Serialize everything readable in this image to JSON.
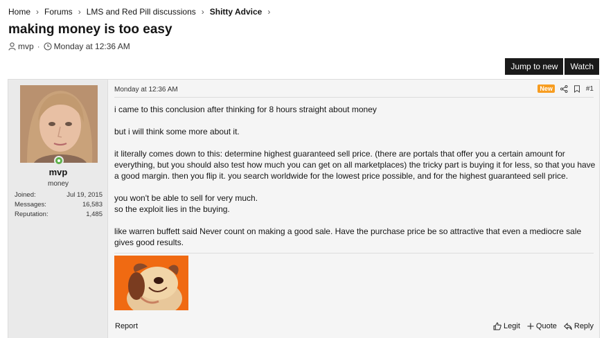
{
  "breadcrumb": {
    "items": [
      "Home",
      "Forums",
      "LMS and Red Pill discussions",
      "Shitty Advice"
    ]
  },
  "thread": {
    "title": "making money is too easy",
    "author": "mvp",
    "date": "Monday at 12:36 AM"
  },
  "buttons": {
    "jump_to_new": "Jump to new",
    "watch": "Watch"
  },
  "user": {
    "name": "mvp",
    "title": "money",
    "online": true,
    "stats": [
      {
        "label": "Joined:",
        "value": "Jul 19, 2015"
      },
      {
        "label": "Messages:",
        "value": "16,583"
      },
      {
        "label": "Reputation:",
        "value": "1,485"
      }
    ]
  },
  "post": {
    "date": "Monday at 12:36 AM",
    "badge": "New",
    "number": "#1",
    "paragraphs": [
      "i came to this conclusion after thinking for 8 hours straight about money",
      "but i will think some more about it.",
      "it literally comes down to this: determine highest guaranteed sell price. (there are portals that offer you a certain amount for everything, but you should also test how much you can get on all marketplaces) the tricky part is buying it for less, so that you have a good margin. then you flip it. you search worldwide for the lowest price possible, and for the highest guaranteed sell price.",
      "you won't be able to sell for very much.\nso the exploit lies in the buying.",
      "like warren buffett said Never count on making a good sale. Have the purchase price be so attractive that even a mediocre sale gives good results."
    ],
    "report": "Report",
    "actions": {
      "legit": "Legit",
      "quote": "Quote",
      "reply": "Reply"
    }
  },
  "icons": {
    "user": "user-icon",
    "clock": "clock-icon",
    "share": "share-icon",
    "bookmark": "bookmark-icon",
    "thumbs_up": "thumbs-up-icon",
    "plus": "plus-icon",
    "reply": "reply-icon"
  },
  "colors": {
    "new_badge": "#f79d21",
    "online": "#5fb14b",
    "button_bg": "#1a1a1a"
  }
}
